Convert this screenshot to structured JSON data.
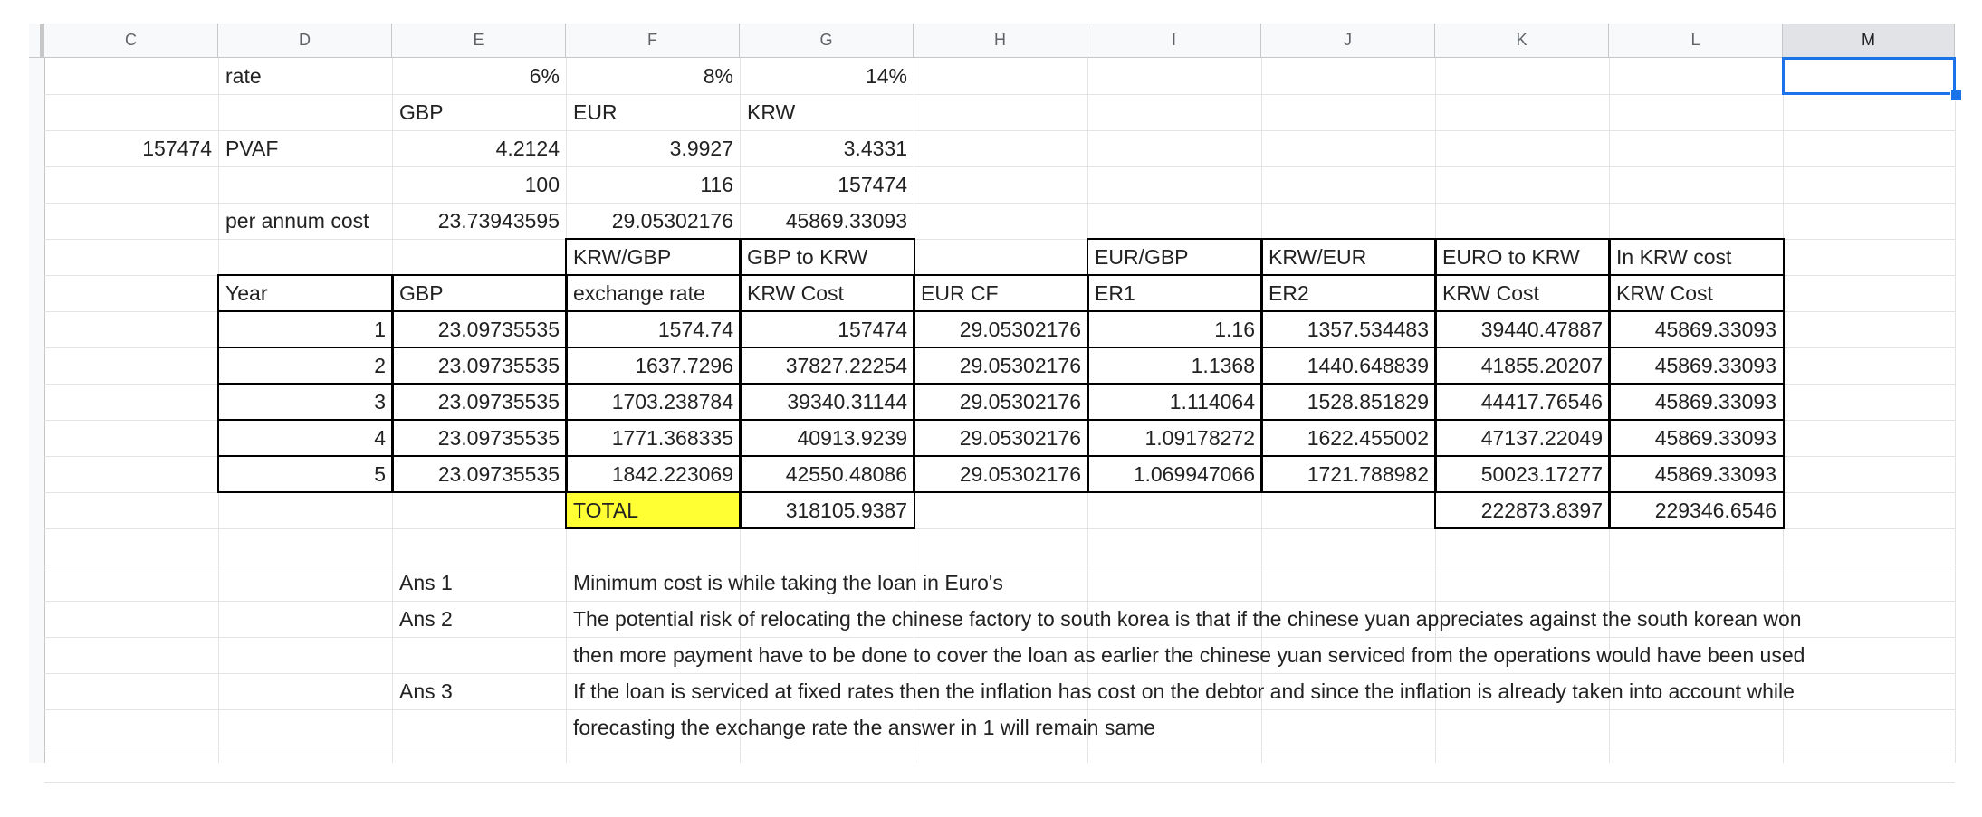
{
  "sheet": {
    "columns": [
      "C",
      "D",
      "E",
      "F",
      "G",
      "H",
      "I",
      "J",
      "K",
      "L",
      "M"
    ],
    "active_column": "M",
    "rows": {
      "rate": {
        "label": "rate",
        "e": "6%",
        "f": "8%",
        "g": "14%"
      },
      "currencies": {
        "e": "GBP",
        "f": "EUR",
        "g": "KRW"
      },
      "pvaf": {
        "c": "157474",
        "label": "PVAF",
        "e": "4.2124",
        "f": "3.9927",
        "g": "3.4331"
      },
      "principal": {
        "e": "100",
        "f": "116",
        "g": "157474"
      },
      "per_annum": {
        "label": "per annum cost",
        "e": "23.73943595",
        "f": "29.05302176",
        "g": "45869.33093"
      }
    },
    "table": {
      "header1": {
        "f": "KRW/GBP",
        "g": "GBP to KRW",
        "i": "EUR/GBP",
        "j": "KRW/EUR",
        "k": "EURO to KRW",
        "l": "In KRW cost"
      },
      "header2": {
        "d": "Year",
        "e": "GBP",
        "f": "exchange rate",
        "g": "KRW Cost",
        "h": "EUR CF",
        "i": "ER1",
        "j": "ER2",
        "k": "KRW Cost",
        "l": "KRW Cost"
      },
      "rows": [
        {
          "d": "1",
          "e": "23.09735535",
          "f": "1574.74",
          "g": "157474",
          "h": "29.05302176",
          "i": "1.16",
          "j": "1357.534483",
          "k": "39440.47887",
          "l": "45869.33093"
        },
        {
          "d": "2",
          "e": "23.09735535",
          "f": "1637.7296",
          "g": "37827.22254",
          "h": "29.05302176",
          "i": "1.1368",
          "j": "1440.648839",
          "k": "41855.20207",
          "l": "45869.33093"
        },
        {
          "d": "3",
          "e": "23.09735535",
          "f": "1703.238784",
          "g": "39340.31144",
          "h": "29.05302176",
          "i": "1.114064",
          "j": "1528.851829",
          "k": "44417.76546",
          "l": "45869.33093"
        },
        {
          "d": "4",
          "e": "23.09735535",
          "f": "1771.368335",
          "g": "40913.9239",
          "h": "29.05302176",
          "i": "1.09178272",
          "j": "1622.455002",
          "k": "47137.22049",
          "l": "45869.33093"
        },
        {
          "d": "5",
          "e": "23.09735535",
          "f": "1842.223069",
          "g": "42550.48086",
          "h": "29.05302176",
          "i": "1.069947066",
          "j": "1721.788982",
          "k": "50023.17277",
          "l": "45869.33093"
        }
      ],
      "total": {
        "f": "TOTAL",
        "g": "318105.9387",
        "k": "222873.8397",
        "l": "229346.6546"
      }
    },
    "answers": [
      {
        "label": "Ans 1",
        "text": "Minimum cost is while taking the loan in Euro's"
      },
      {
        "label": "Ans 2",
        "text": "The potential risk of relocating the chinese factory to south korea is that if the chinese yuan appreciates against the south  korean won"
      },
      {
        "label": "",
        "text": "then more payment have to be done to cover the loan as earlier the chinese yuan serviced from  the operations would have been used"
      },
      {
        "label": "Ans 3",
        "text": "If the loan is serviced at fixed rates then the inflation has cost on the debtor and since the inflation is already taken into account while"
      },
      {
        "label": "",
        "text": "forecasting the exchange rate the answer in 1 will remain same"
      }
    ],
    "colors": {
      "selection": "#1a73e8",
      "highlight": "#ffff33",
      "grid": "#e2e3e3",
      "border": "#000000"
    }
  }
}
